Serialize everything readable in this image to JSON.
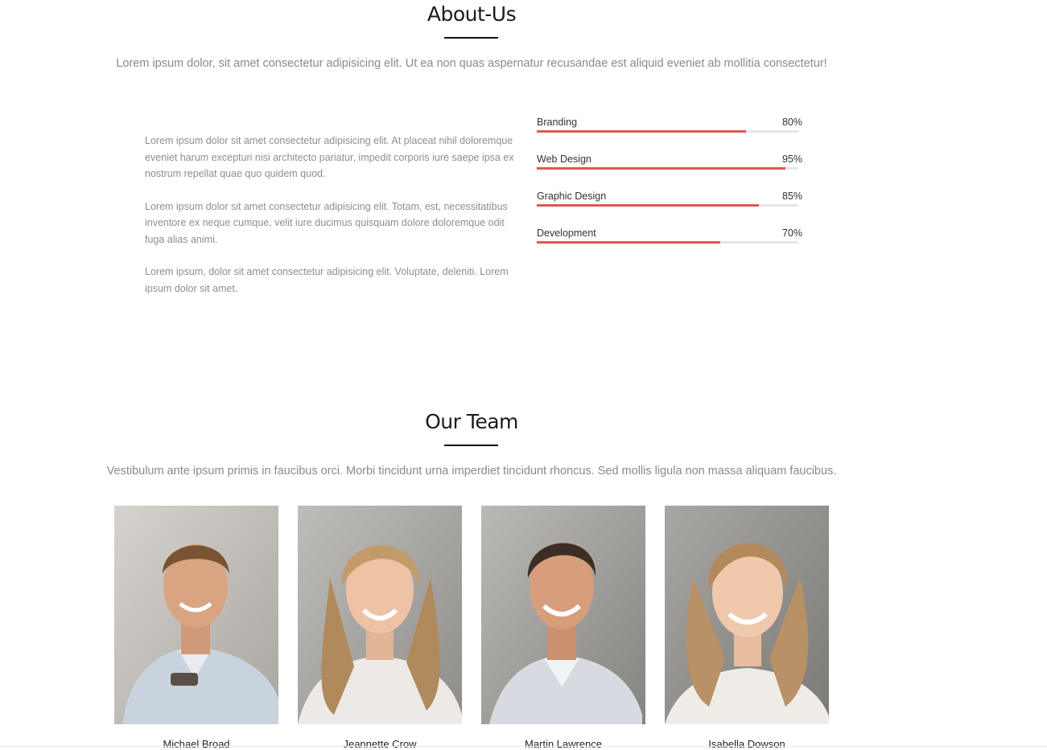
{
  "about": {
    "title": "About-Us",
    "lead": "Lorem ipsum dolor, sit amet consectetur adipisicing elit. Ut ea non quas aspernatur recusandae est aliquid eveniet ab mollitia consectetur!",
    "paragraphs": [
      "Lorem ipsum dolor sit amet consectetur adipisicing elit. At placeat nihil doloremque eveniet harum excepturi nisi architecto pariatur, impedit corporis iure saepe ipsa ex nostrum repellat quae quo quidem quod.",
      "Lorem ipsum dolor sit amet consectetur adipisicing elit. Totam, est, necessitatibus inventore ex neque cumque, velit iure ducimus quisquam dolore doloremque odit fuga alias animi.",
      "Lorem ipsum, dolor sit amet consectetur adipisicing elit. Voluptate, deleniti. Lorem ipsum dolor sit amet."
    ],
    "skills": [
      {
        "name": "Branding",
        "percent_label": "80%",
        "value": 0.8
      },
      {
        "name": "Web Design",
        "percent_label": "95%",
        "value": 0.95
      },
      {
        "name": "Graphic Design",
        "percent_label": "85%",
        "value": 0.85
      },
      {
        "name": "Development",
        "percent_label": "70%",
        "value": 0.7
      }
    ]
  },
  "team": {
    "title": "Our Team",
    "lead": "Vestibulum ante ipsum primis in faucibus orci. Morbi tincidunt urna imperdiet tincidunt rhoncus. Sed mollis ligula non massa aliquam faucibus.",
    "members": [
      {
        "name": "Michael Broad"
      },
      {
        "name": "Jeannette Crow"
      },
      {
        "name": "Martin Lawrence"
      },
      {
        "name": "Isabella Dowson"
      }
    ]
  },
  "colors": {
    "accent": "#e05656",
    "track": "#e6e6e6",
    "muted_text": "#8a8a8a"
  }
}
